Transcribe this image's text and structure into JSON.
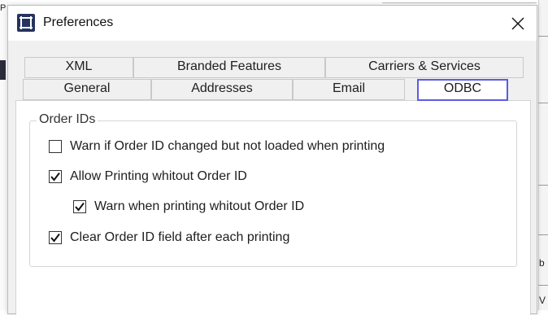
{
  "background": {
    "left_fragment": "P",
    "right_fragments": [
      "b",
      "V"
    ]
  },
  "window": {
    "title": "Preferences",
    "icon": "app-window-icon",
    "close_icon": "close-icon"
  },
  "tabs": {
    "row1": [
      {
        "label": "XML",
        "selected": false
      },
      {
        "label": "Branded Features",
        "selected": false
      },
      {
        "label": "Carriers & Services",
        "selected": false
      }
    ],
    "row2": [
      {
        "label": "General",
        "selected": false
      },
      {
        "label": "Addresses",
        "selected": false
      },
      {
        "label": "Email",
        "selected": false
      },
      {
        "label": "ODBC",
        "selected": true
      }
    ]
  },
  "group": {
    "title": "Order IDs",
    "options": [
      {
        "label": "Warn if Order ID changed but not loaded when printing",
        "checked": false
      },
      {
        "label": "Allow Printing whitout Order ID",
        "checked": true
      },
      {
        "label": "Warn when printing whitout Order ID",
        "checked": true,
        "indented": true
      },
      {
        "label": "Clear Order ID field after each printing",
        "checked": true
      }
    ]
  },
  "colors": {
    "selected_tab_border": "#5b5be6",
    "icon_bg": "#27335f"
  }
}
